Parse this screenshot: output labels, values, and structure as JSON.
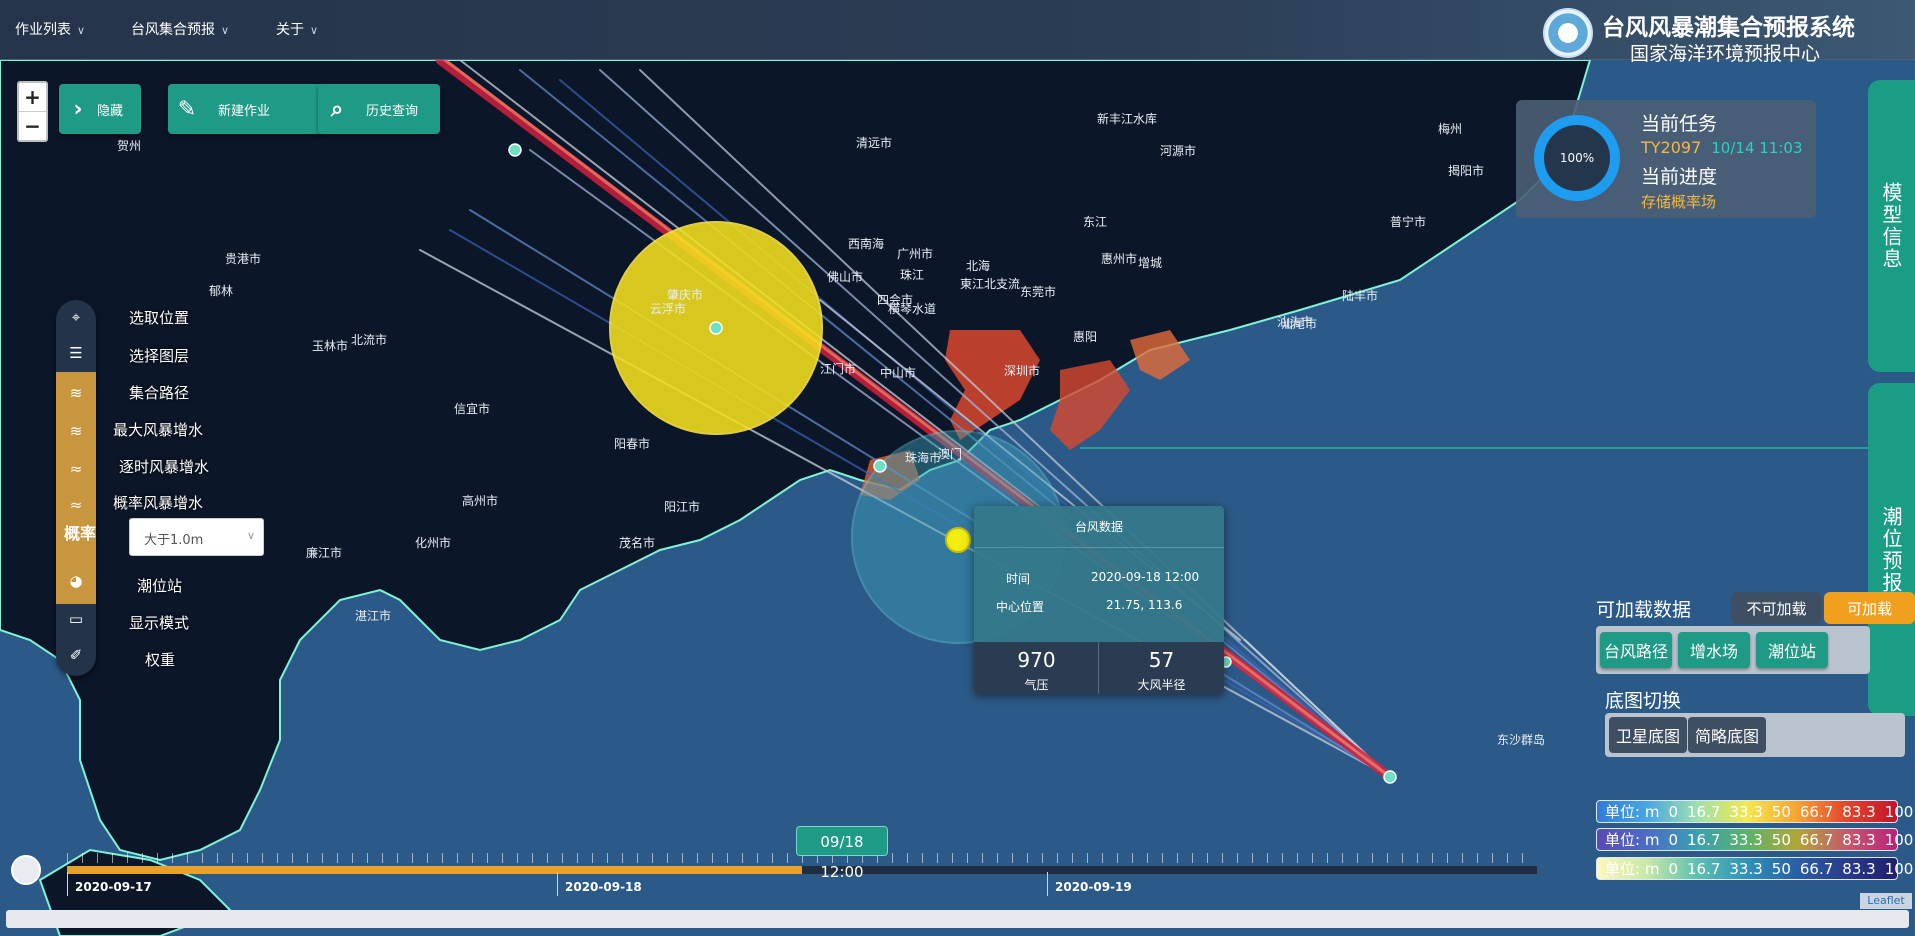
{
  "header": {
    "menus": [
      "作业列表",
      "台风集合预报",
      "关于"
    ],
    "title": "台风风暴潮集合预报系统",
    "subtitle": "国家海洋环境预报中心"
  },
  "zoom": {
    "in": "+",
    "out": "−"
  },
  "actions": [
    {
      "icon": "chevron-right-icon",
      "label": "隐藏"
    },
    {
      "icon": "edit-icon",
      "label": "新建作业"
    },
    {
      "icon": "search-icon",
      "label": "历史查询"
    }
  ],
  "toolbar": {
    "items": [
      "选取位置",
      "选择图层",
      "集合路径",
      "最大风暴增水",
      "逐时风暴增水",
      "概率风暴增水",
      "潮位站",
      "显示模式",
      "权重"
    ],
    "prob_label": "概率",
    "prob_select_value": "大于1.0m"
  },
  "task": {
    "progress_text": "100%",
    "progress_value": 1.0,
    "current_task_label": "当前任务",
    "task_id": "TY2097",
    "task_time": "10/14 11:03",
    "progress_label": "当前进度",
    "progress_status": "存储概率场"
  },
  "right_tabs": [
    "模型信息",
    "潮位预报"
  ],
  "load_panel": {
    "title": "可加载数据",
    "not_loadable": "不可加载",
    "loadable": "可加载",
    "buttons": [
      "台风路径",
      "增水场",
      "潮位站"
    ]
  },
  "basemap": {
    "title": "底图切换",
    "buttons": [
      "卫星底图",
      "简略底图"
    ]
  },
  "legends": [
    {
      "unit": "单位: m",
      "ticks": [
        "0",
        "16.7",
        "33.3",
        "50",
        "66.7",
        "83.3",
        "100"
      ],
      "gradient": "linear-gradient(90deg,#2f7bd8,#4aa6e0,#9ee0b0,#f4e84a,#f6a336,#e2452d,#c2132a)"
    },
    {
      "unit": "单位: m",
      "ticks": [
        "0",
        "16.7",
        "33.3",
        "50",
        "66.7",
        "83.3",
        "100"
      ],
      "gradient": "linear-gradient(90deg,#5a4ab4,#4d6cc4,#3aa0b0,#5ab36a,#b0a63a,#c45a6a,#b8237a)"
    },
    {
      "unit": "单位: m",
      "ticks": [
        "0",
        "16.7",
        "33.3",
        "50",
        "66.7",
        "83.3",
        "100"
      ],
      "gradient": "linear-gradient(90deg,#fff7c0,#c8e8a8,#5fc0b0,#2f92b8,#2a5fa6,#2a3a8a,#1f1f6a)"
    }
  ],
  "popup": {
    "title": "台风数据",
    "time_label": "时间",
    "time_value": "2020-09-18 12:00",
    "center_label": "中心位置",
    "center_value": "21.75, 113.6",
    "pressure_value": "970",
    "pressure_label": "气压",
    "radius_value": "57",
    "radius_label": "大风半径"
  },
  "timeline": {
    "current": "09/18 12:00",
    "progress": 0.5,
    "dates": [
      "2020-09-17",
      "2020-09-18",
      "2020-09-19"
    ]
  },
  "attribution": "Leaflet",
  "map": {
    "cities": [
      "清远市",
      "河源市",
      "新丰江水库",
      "梅州",
      "揭阳市",
      "广州市",
      "佛山市",
      "东莞市",
      "惠州市",
      "东江",
      "汕尾市",
      "汕头市",
      "深圳市",
      "江门市",
      "珠海市",
      "中山市",
      "肇庆市",
      "云浮市",
      "阳春市",
      "阳江市",
      "茂名市",
      "湛江市",
      "玉林市",
      "北流市",
      "贵港市",
      "贺州",
      "郁林",
      "化州市",
      "信宜市",
      "高州市",
      "廉江市",
      "东沙群岛",
      "西南海",
      "陆丰市",
      "普宁市",
      "四会市",
      "增城",
      "惠阳",
      "澳门",
      "珠江",
      "北海",
      "東江北支流",
      "横琴水道"
    ],
    "colors": {
      "sea": "#2c5a88",
      "land": "#0b1628",
      "coast": "#7ef3d8",
      "surge": "#d9482e",
      "track": "#d3203e"
    }
  }
}
